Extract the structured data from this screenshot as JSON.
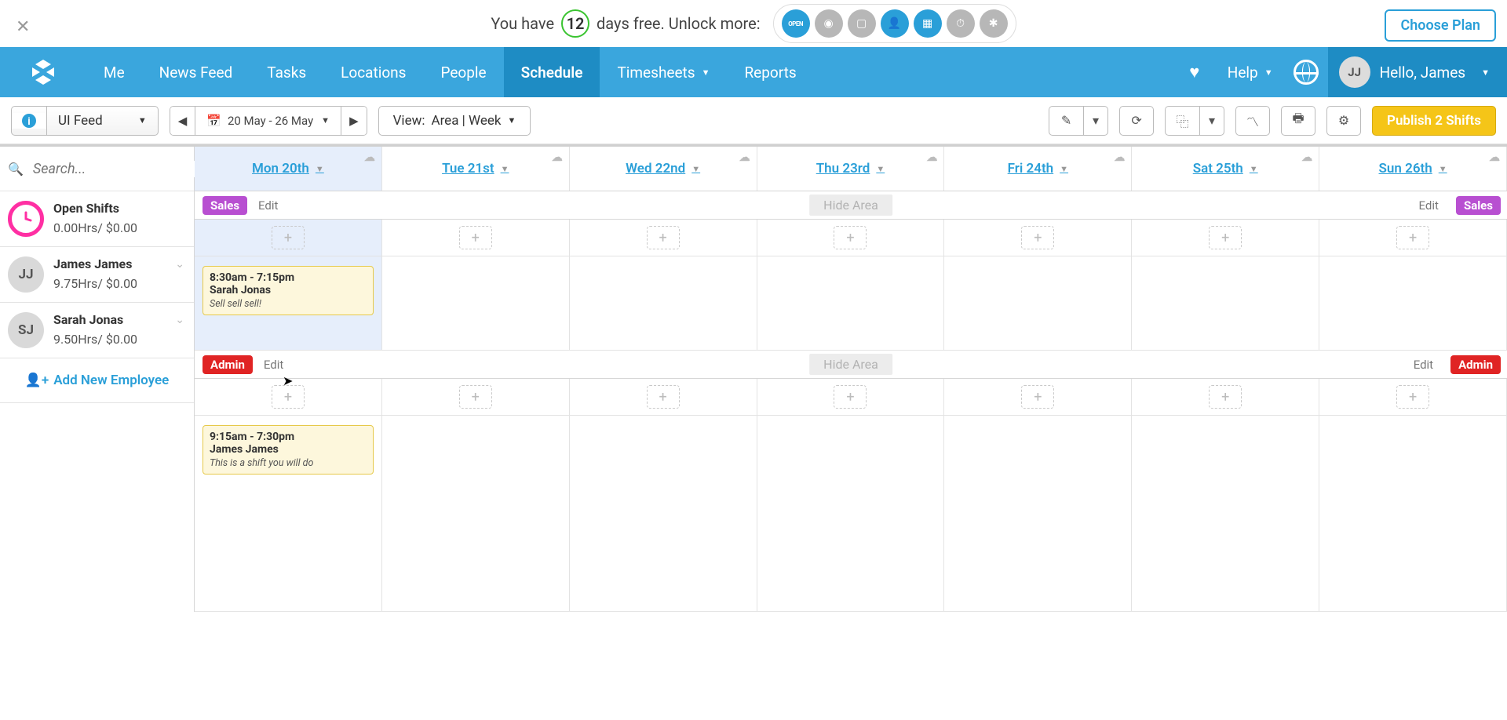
{
  "trial": {
    "prefix": "You have",
    "days": "12",
    "suffix": "days free. Unlock more:",
    "choose_plan": "Choose Plan"
  },
  "nav": {
    "items": [
      "Me",
      "News Feed",
      "Tasks",
      "Locations",
      "People",
      "Schedule",
      "Timesheets",
      "Reports"
    ],
    "help": "Help",
    "hello": "Hello, James",
    "avatar": "JJ"
  },
  "toolbar": {
    "location": "UI Feed",
    "date_range": "20 May - 26 May",
    "view_label": "View:",
    "view_value": "Area | Week",
    "publish": "Publish 2 Shifts"
  },
  "sidebar": {
    "search_placeholder": "Search...",
    "add_employee": "Add New Employee",
    "employees": [
      {
        "avatar": "",
        "name": "Open Shifts",
        "hours": "0.00Hrs/ $0.00",
        "type": "open"
      },
      {
        "avatar": "JJ",
        "name": "James James",
        "hours": "9.75Hrs/ $0.00",
        "type": "gray"
      },
      {
        "avatar": "SJ",
        "name": "Sarah Jonas",
        "hours": "9.50Hrs/ $0.00",
        "type": "gray"
      }
    ]
  },
  "days": [
    "Mon 20th",
    "Tue 21st",
    "Wed 22nd",
    "Thu 23rd",
    "Fri 24th",
    "Sat 25th",
    "Sun 26th"
  ],
  "areas": [
    {
      "name": "Sales",
      "color": "sales",
      "edit": "Edit",
      "hide": "Hide Area",
      "shifts": [
        {
          "day": 0,
          "time": "8:30am - 7:15pm",
          "who": "Sarah Jonas",
          "note": "Sell sell sell!"
        }
      ]
    },
    {
      "name": "Admin",
      "color": "admin",
      "edit": "Edit",
      "hide": "Hide Area",
      "shifts": [
        {
          "day": 0,
          "time": "9:15am - 7:30pm",
          "who": "James James",
          "note": "This is a shift you will do"
        }
      ]
    }
  ]
}
